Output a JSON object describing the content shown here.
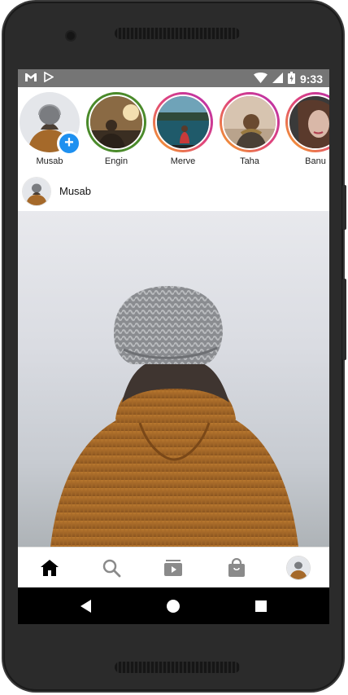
{
  "status_bar": {
    "time": "9:33",
    "icons_left": [
      "gmail-icon",
      "play-store-icon"
    ],
    "icons_right": [
      "wifi-icon",
      "signal-icon",
      "battery-icon"
    ]
  },
  "stories": [
    {
      "name": "Musab",
      "ring_color": "none",
      "has_add_button": true
    },
    {
      "name": "Engin",
      "ring_color": "#4a8a2a"
    },
    {
      "name": "Merve",
      "ring_color": "#e0457b"
    },
    {
      "name": "Taha",
      "ring_color": "#e0457b"
    },
    {
      "name": "Banu",
      "ring_color": "#e0457b"
    }
  ],
  "post": {
    "username": "Musab"
  },
  "bottom_nav": {
    "items": [
      "home-icon",
      "search-icon",
      "video-icon",
      "shop-icon",
      "profile-avatar"
    ],
    "active": "home-icon"
  },
  "system_nav": {
    "buttons": [
      "back-button",
      "home-button",
      "recents-button"
    ]
  },
  "colors": {
    "accent_blue": "#1e90f0",
    "status_bar": "#757575",
    "story_ring_green": "#4a8a2a",
    "story_ring_gradient": [
      "#f5a623",
      "#e0457b",
      "#b62db0"
    ]
  }
}
